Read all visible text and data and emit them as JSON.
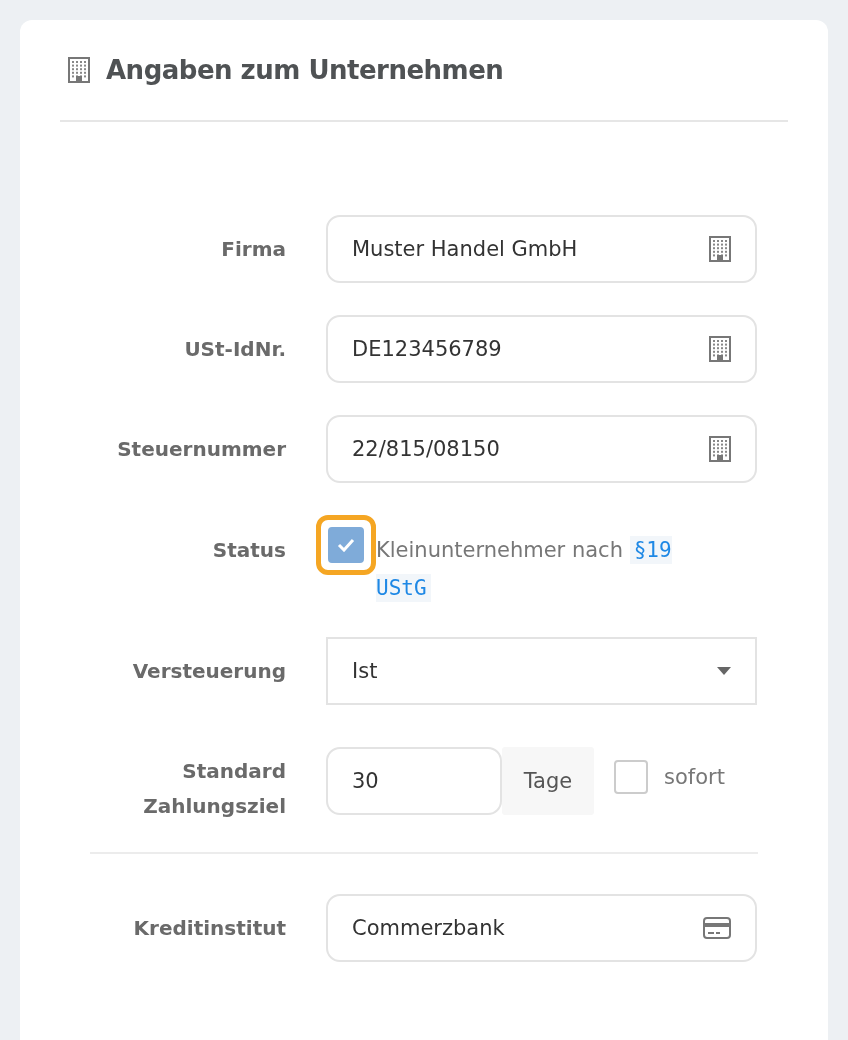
{
  "header": {
    "title": "Angaben zum Unternehmen"
  },
  "rows": [
    {
      "kind": "company",
      "label": "Firma",
      "value": "Muster Handel GmbH"
    },
    {
      "kind": "company",
      "label": "USt-IdNr.",
      "value": "DE123456789"
    },
    {
      "kind": "company",
      "label": "Steuernummer",
      "value": "22/815/08150"
    },
    {
      "kind": "checkbox",
      "label": "Status",
      "checked": true,
      "focused": true,
      "text": "Kleinunternehmer nach",
      "code": "§19 UStG"
    },
    {
      "kind": "select",
      "label": "Versteuerung",
      "value": "Ist"
    },
    {
      "kind": "days",
      "label": "Standard Zahlungsziel",
      "value": "30",
      "unit": "Tage",
      "option": {
        "label": "sofort",
        "checked": false
      }
    },
    {
      "kind": "divider"
    },
    {
      "kind": "bank",
      "label": "Kreditinstitut",
      "value": "Commerzbank"
    }
  ]
}
